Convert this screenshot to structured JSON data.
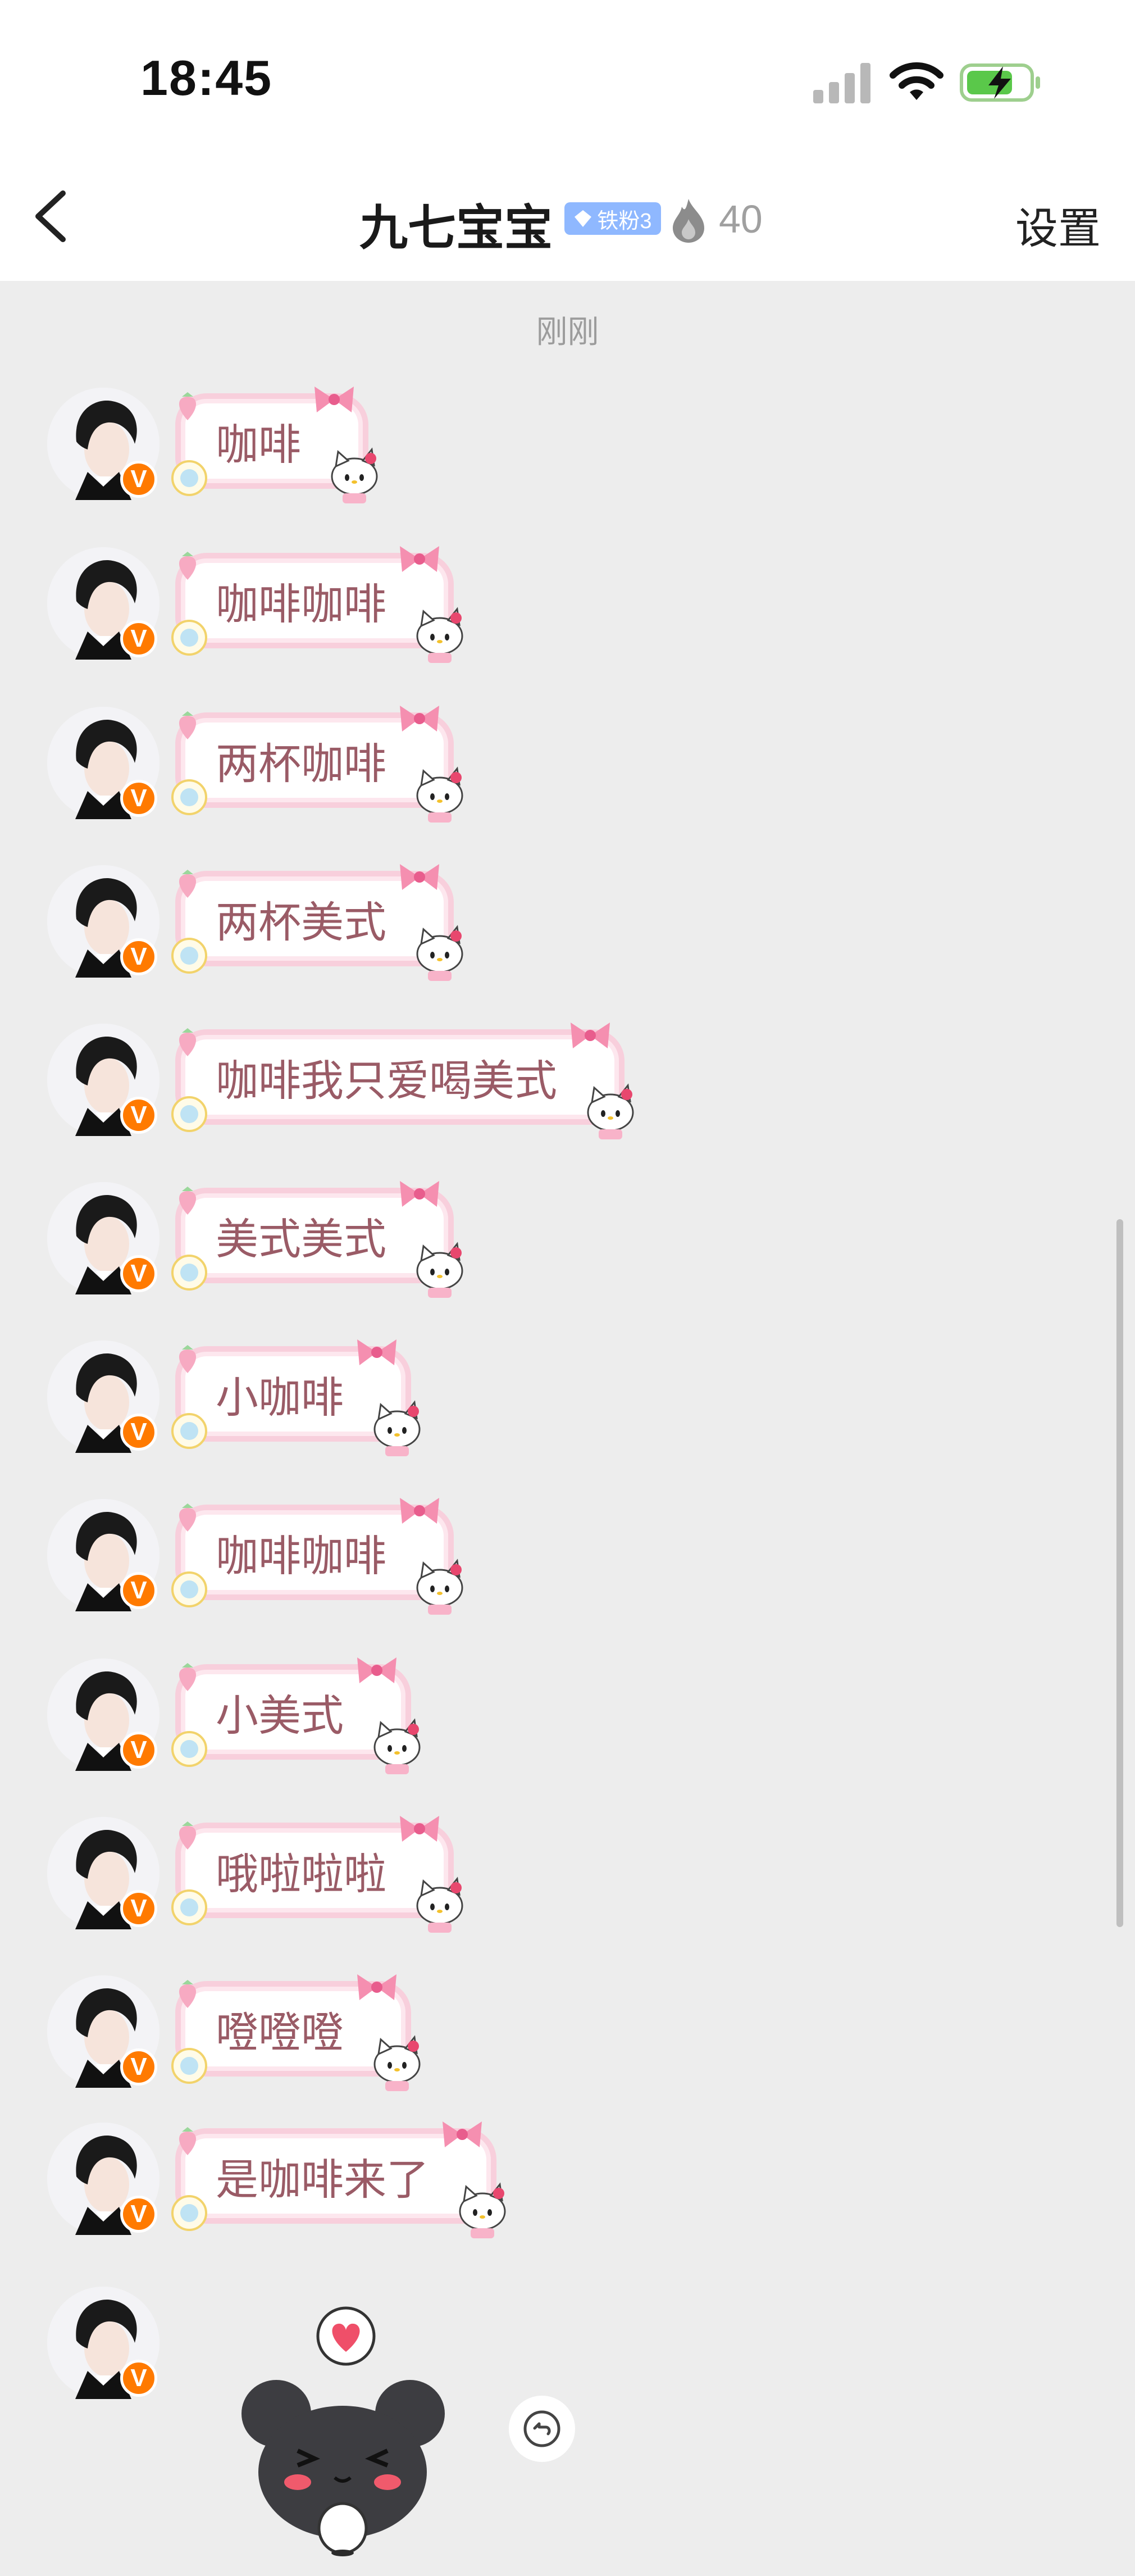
{
  "status_bar": {
    "time": "18:45"
  },
  "nav": {
    "title": "九七宝宝",
    "fan_badge": "铁粉3",
    "fan_count": "40",
    "settings_label": "设置"
  },
  "timestamp": "刚刚",
  "messages": [
    {
      "text": "咖啡"
    },
    {
      "text": "咖啡咖啡"
    },
    {
      "text": "两杯咖啡"
    },
    {
      "text": "两杯美式"
    },
    {
      "text": "咖啡我只爱喝美式"
    },
    {
      "text": "美式美式"
    },
    {
      "text": "小咖啡"
    },
    {
      "text": "咖啡咖啡"
    },
    {
      "text": "小美式"
    },
    {
      "text": "哦啦啦啦"
    },
    {
      "text": "噔噔噔"
    },
    {
      "text": "是咖啡来了"
    }
  ],
  "avatar_badge": "V",
  "colors": {
    "bubble_border": "#f8cfdc",
    "bubble_text": "#9a5b66",
    "v_badge": "#ff7a00"
  }
}
